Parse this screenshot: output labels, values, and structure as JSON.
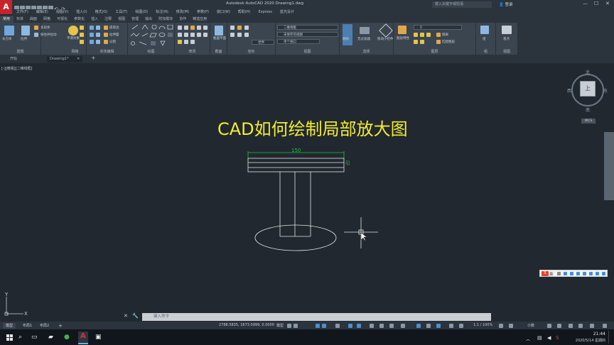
{
  "app": {
    "logo_letter": "A",
    "title": "Autodesk AutoCAD 2020    Drawing1.dwg",
    "search_placeholder": "键入关键字或短语",
    "login": "登录",
    "window_controls": [
      "—",
      "☐",
      "✕"
    ]
  },
  "menubar": [
    "文件(F)",
    "编辑(E)",
    "视图(V)",
    "插入(I)",
    "格式(O)",
    "工具(T)",
    "绘图(D)",
    "标注(N)",
    "修改(M)",
    "参数(P)",
    "窗口(W)",
    "帮助(H)",
    "Express",
    "蓝光设计"
  ],
  "ribbon_tabs": [
    {
      "label": "常用",
      "active": true
    },
    {
      "label": "实体",
      "active": false
    },
    {
      "label": "曲面",
      "active": false
    },
    {
      "label": "网格",
      "active": false
    },
    {
      "label": "可视化",
      "active": false
    },
    {
      "label": "参数化",
      "active": false
    },
    {
      "label": "插入",
      "active": false
    },
    {
      "label": "注释",
      "active": false
    },
    {
      "label": "视图",
      "active": false
    },
    {
      "label": "管理",
      "active": false
    },
    {
      "label": "输出",
      "active": false
    },
    {
      "label": "附加模块",
      "active": false
    },
    {
      "label": "协作",
      "active": false
    },
    {
      "label": "精选应用",
      "active": false
    }
  ],
  "ribbon": {
    "panels": [
      "建模",
      "网格",
      "实体编辑",
      "绘图",
      "修改",
      "截面",
      "坐标",
      "视图",
      "选择",
      "图层",
      "组",
      "视图"
    ],
    "tools": {
      "box": "长方体",
      "extrude": "拉伸",
      "polysolid": "多段体",
      "presspull": "按住并拉动",
      "smooth": "平滑对象",
      "extract_edges": "提取边",
      "extrude_face": "拉伸面",
      "separate": "分割",
      "section_plane": "截面平面",
      "culling": "剔除",
      "move_gizmo": "移动小控件",
      "layer_properties": "图层特性",
      "isolate": "隔离",
      "match_layer": "匹配图层",
      "group": "组",
      "base": "基点"
    },
    "combos": {
      "visual_style": "二维线框",
      "view": "未保存的视图",
      "world": "世界",
      "viewport": "单个视口",
      "layer": "0"
    }
  },
  "doc_tabs": [
    {
      "label": "开始"
    },
    {
      "label": "Drawing1*"
    }
  ],
  "viewport_label": "[-][俯视][二维线框]",
  "canvas": {
    "headline": "CAD如何绘制局部放大图",
    "dimension_text": "150",
    "dimension_side_text": "引"
  },
  "viewcube": {
    "north": "北",
    "south": "南",
    "east": "东",
    "west": "西",
    "face": "上",
    "wcs": "WCS"
  },
  "command": {
    "placeholder": "键入命令"
  },
  "model_tabs": [
    "模型",
    "布局1",
    "布局2"
  ],
  "status": {
    "coords": "2788.5835, 1673.0999, 0.0000",
    "model": "模型",
    "scale": "1:1 / 100%",
    "units": "小数"
  },
  "tray": {
    "time": "21:44",
    "date": "2020/5/14 星期四"
  },
  "colors": {
    "canvas": "#212830",
    "headline": "#f4ec2a",
    "dimension": "#19c43a",
    "geometry": "#e6e6e6",
    "accent_red": "#c8242c"
  }
}
